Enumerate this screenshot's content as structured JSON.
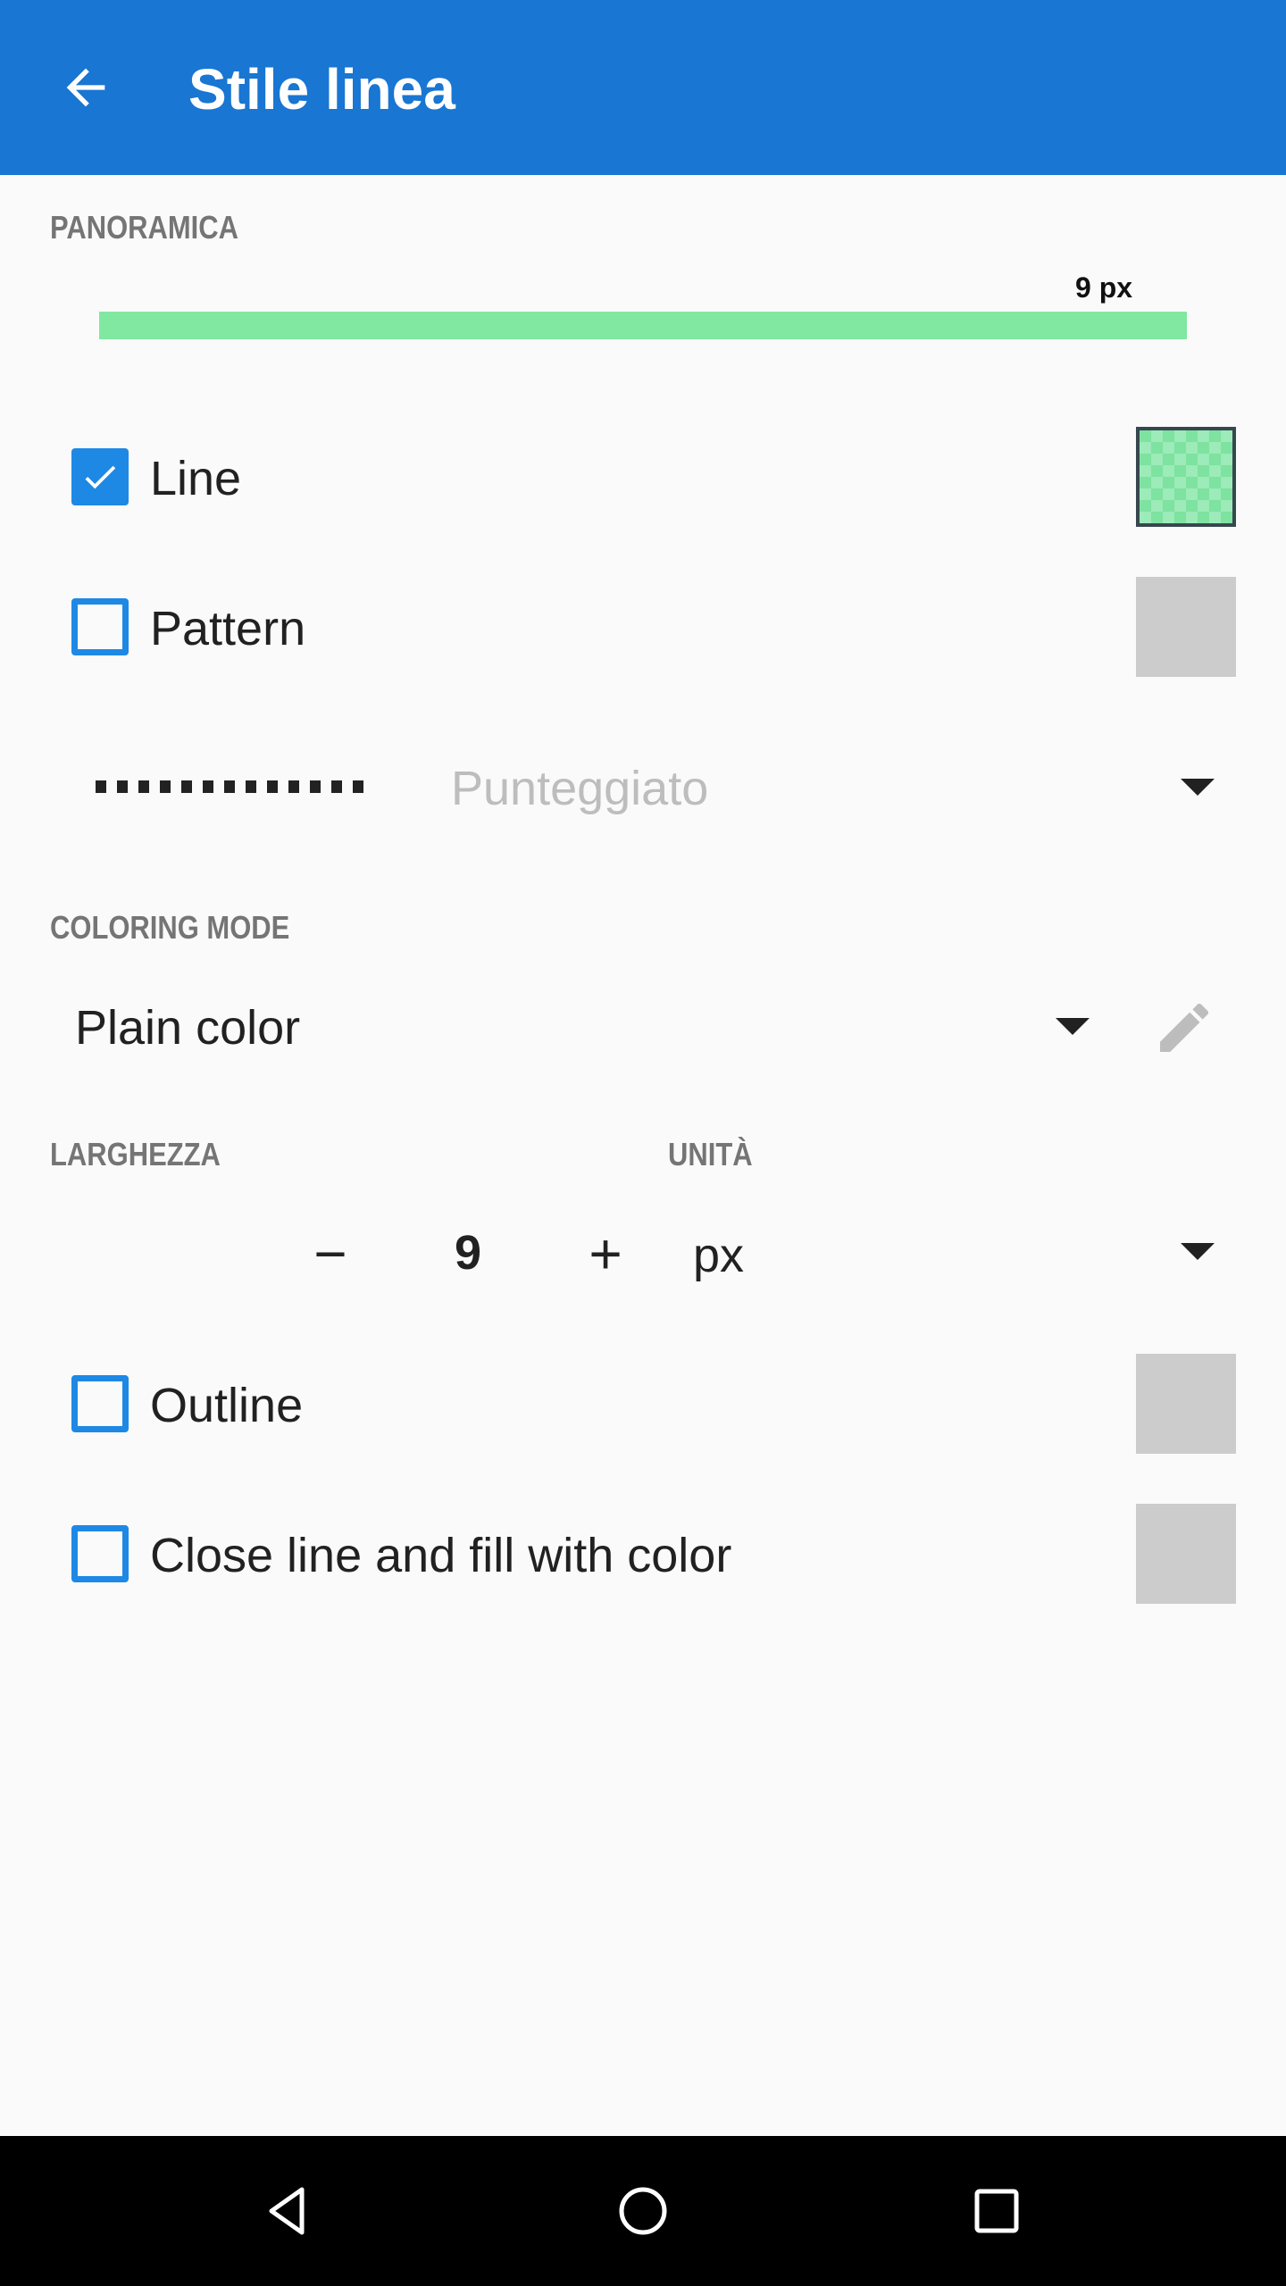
{
  "appbar": {
    "title": "Stile linea",
    "back_icon": "arrow-back-icon"
  },
  "preview": {
    "section_label": "PANORAMICA",
    "width_label": "9 px",
    "line_color": "#80e8a0"
  },
  "line_option": {
    "label": "Line",
    "checked": true,
    "swatch_color": "#7ee2a0"
  },
  "pattern_option": {
    "label": "Pattern",
    "checked": false,
    "swatch_color": "#cccccc"
  },
  "pattern_select": {
    "selected": "Punteggiato"
  },
  "coloring": {
    "section_label": "COLORING MODE",
    "selected": "Plain color",
    "edit_icon": "pencil-icon"
  },
  "width": {
    "section_label": "LARGHEZZA",
    "minus": "−",
    "value": "9",
    "plus": "+"
  },
  "unit": {
    "section_label": "UNITÀ",
    "selected": "px"
  },
  "outline_option": {
    "label": "Outline",
    "checked": false,
    "swatch_color": "#cccccc"
  },
  "close_fill_option": {
    "label": "Close line and fill with color",
    "checked": false,
    "swatch_color": "#cccccc"
  },
  "colors": {
    "primary": "#1976d2",
    "accent": "#1e88e5",
    "background": "#fafafa"
  },
  "navbar": {
    "back": "nav-back-icon",
    "home": "nav-home-icon",
    "recents": "nav-recents-icon"
  }
}
